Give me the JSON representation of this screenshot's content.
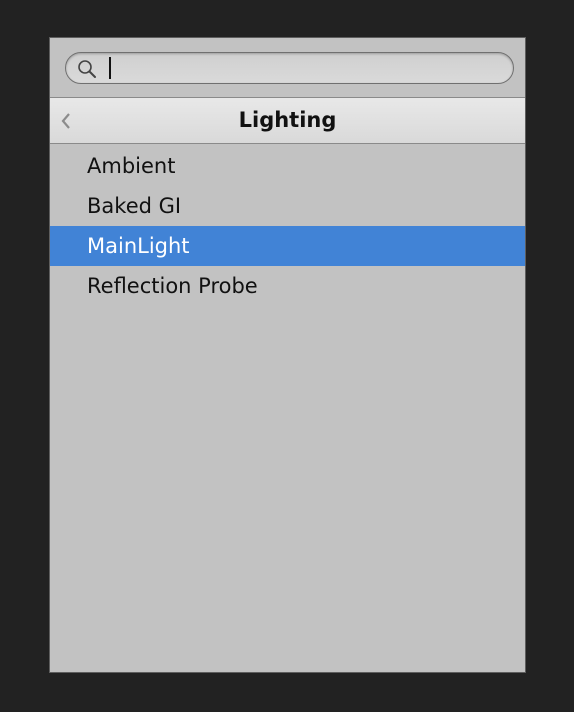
{
  "search": {
    "value": "",
    "icon": "search-icon"
  },
  "header": {
    "title": "Lighting",
    "back_icon": "chevron-left-icon"
  },
  "list": {
    "items": [
      {
        "label": "Ambient",
        "selected": false
      },
      {
        "label": "Baked GI",
        "selected": false
      },
      {
        "label": "MainLight",
        "selected": true
      },
      {
        "label": "Reflection Probe",
        "selected": false
      }
    ]
  },
  "colors": {
    "selection": "#4183d6",
    "panel_bg": "#c2c2c2",
    "window_bg": "#222222"
  }
}
